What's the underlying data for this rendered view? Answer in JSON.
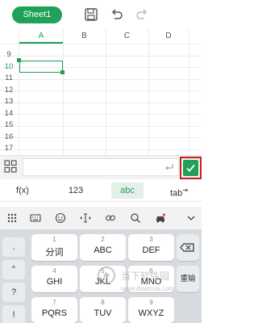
{
  "toolbar": {
    "sheet_label": "Sheet1",
    "save_icon": "save-icon",
    "undo_icon": "undo-icon",
    "redo_icon": "redo-icon"
  },
  "grid": {
    "columns": [
      "A",
      "B",
      "C",
      "D"
    ],
    "rows": [
      "9",
      "10",
      "11",
      "12",
      "13",
      "14",
      "15",
      "16",
      "17"
    ],
    "active_column": "A",
    "active_row": "10",
    "selected_cell": "A10"
  },
  "formula": {
    "value": "",
    "enter_icon": "enter-icon",
    "confirm_icon": "check-icon"
  },
  "modes": {
    "fx": "f(x)",
    "num": "123",
    "abc": "abc",
    "tab": "tab",
    "active": "abc"
  },
  "keyboard": {
    "side": [
      ".",
      "°",
      "?",
      "!"
    ],
    "keys": [
      {
        "num": "1",
        "label": "分词"
      },
      {
        "num": "2",
        "label": "ABC"
      },
      {
        "num": "3",
        "label": "DEF"
      },
      {
        "num": "4",
        "label": "GHI"
      },
      {
        "num": "5",
        "label": "JKL"
      },
      {
        "num": "6",
        "label": "MNO"
      },
      {
        "num": "7",
        "label": "PQRS"
      },
      {
        "num": "8",
        "label": "TUV"
      },
      {
        "num": "9",
        "label": "WXYZ"
      }
    ],
    "reenter": "重输"
  },
  "watermark": {
    "title": "当下软件园",
    "url": "www.downxia.com"
  },
  "colors": {
    "accent": "#1fa157",
    "highlight_border": "#c81e1e"
  }
}
